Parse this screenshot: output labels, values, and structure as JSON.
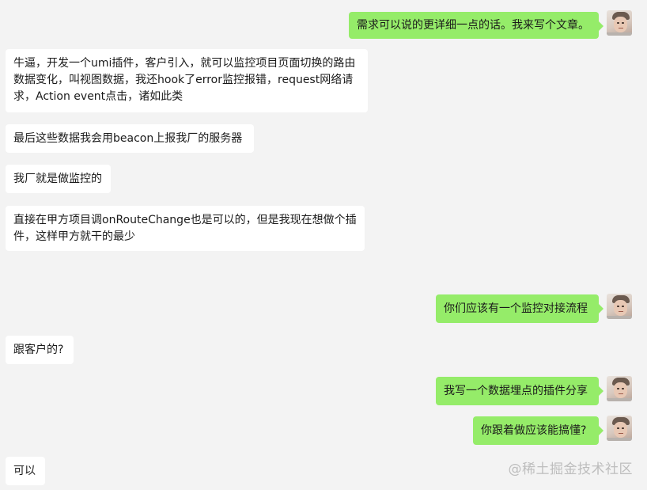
{
  "messages": [
    {
      "side": "right",
      "text": "需求可以说的更详细一点的话。我来写个文章。"
    },
    {
      "side": "left",
      "text": "牛逼，开发一个umi插件，客户引入，就可以监控项目页面切换的路由数据变化，叫视图数据，我还hook了error监控报错，request网络请求，Action event点击，诸如此类"
    },
    {
      "side": "left",
      "text": "最后这些数据我会用beacon上报我厂的服务器"
    },
    {
      "side": "left",
      "text": "我厂就是做监控的"
    },
    {
      "side": "left",
      "text": "直接在甲方项目调onRouteChange也是可以的，但是我现在想做个插件，这样甲方就干的最少"
    },
    {
      "side": "right",
      "text": "你们应该有一个监控对接流程"
    },
    {
      "side": "left",
      "text": "跟客户的?"
    },
    {
      "side": "right",
      "text": "我写一个数据埋点的插件分享"
    },
    {
      "side": "right",
      "text": "你跟着做应该能搞懂?"
    },
    {
      "side": "left",
      "text": "可以"
    }
  ],
  "watermark": "@稀土掘金技术社区"
}
